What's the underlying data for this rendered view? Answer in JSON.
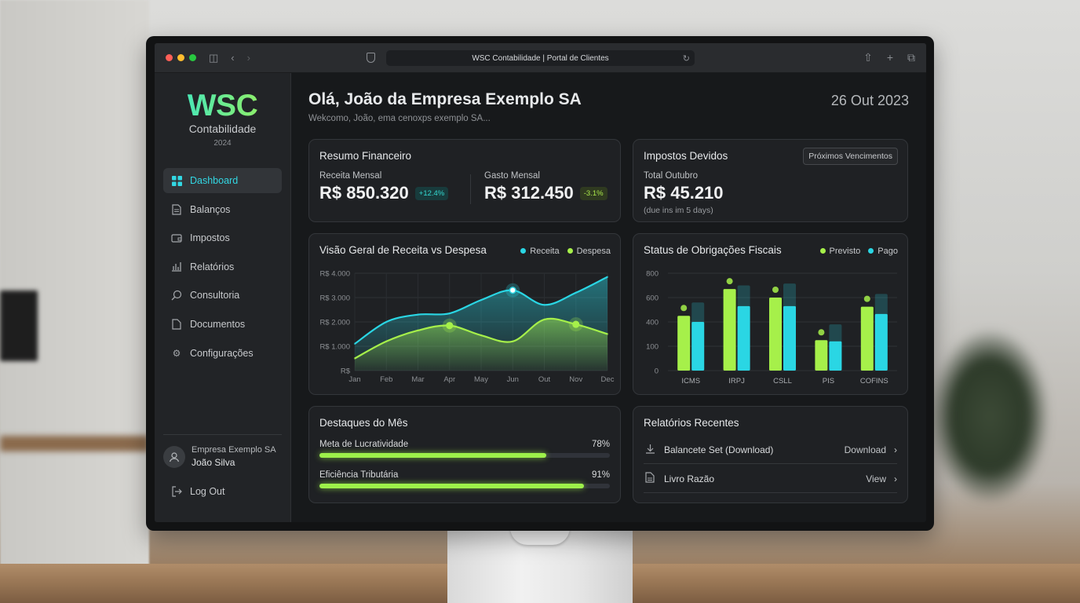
{
  "browser": {
    "url_title": "WSC Contabilidade | Portal de Clientes"
  },
  "brand": {
    "logo": "WSC",
    "subtitle": "Contabilidade",
    "year": "2024"
  },
  "sidebar": {
    "items": [
      {
        "label": "Dashboard",
        "icon": "grid-icon",
        "active": true
      },
      {
        "label": "Balanços",
        "icon": "document-icon",
        "active": false
      },
      {
        "label": "Impostos",
        "icon": "wallet-icon",
        "active": false
      },
      {
        "label": "Relatórios",
        "icon": "bar-chart-icon",
        "active": false
      },
      {
        "label": "Consultoria",
        "icon": "chat-icon",
        "active": false
      },
      {
        "label": "Documentos",
        "icon": "file-icon",
        "active": false
      },
      {
        "label": "Configurações",
        "icon": "gear-icon",
        "active": false
      }
    ],
    "user": {
      "company": "Empresa Exemplo SA",
      "name": "João Silva"
    },
    "logout": "Log Out"
  },
  "header": {
    "greeting": "Olá, João da Empresa Exemplo SA",
    "subtitle": "Wekcomo, João, ema cenoxps exemplo SA...",
    "date": "26 Out 2023"
  },
  "resumo": {
    "title": "Resumo Financeiro",
    "receita_label": "Receita Mensal",
    "receita_value": "R$ 850.320",
    "receita_change": "+12.4%",
    "gasto_label": "Gasto Mensal",
    "gasto_value": "R$ 312.450",
    "gasto_change": "-3.1%"
  },
  "impostos": {
    "title": "Impostos Devidos",
    "button": "Próximos Vencimentos",
    "total_label": "Total Outubro",
    "total_value": "R$ 45.210",
    "note": "(due ins im 5 days)"
  },
  "colors": {
    "teal": "#2ad6e4",
    "lime": "#a6f04a"
  },
  "chart_data": [
    {
      "type": "area",
      "title": "Visão Geral de Receita vs Despesa",
      "categories": [
        "Jan",
        "Feb",
        "Mar",
        "Apr",
        "May",
        "Jun",
        "Out",
        "Nov",
        "Dec"
      ],
      "y_ticks": [
        "R$",
        "R$ 1.000",
        "R$ 2.000",
        "R$ 3.000",
        "R$ 4.000"
      ],
      "ylim": [
        0,
        4000
      ],
      "grid": true,
      "legend_position": "top-right",
      "series": [
        {
          "name": "Receita",
          "color": "#2ad6e4",
          "values": [
            1100,
            2000,
            2300,
            2350,
            2900,
            3300,
            2700,
            3200,
            3850
          ]
        },
        {
          "name": "Despesa",
          "color": "#a6f04a",
          "values": [
            500,
            1200,
            1650,
            1850,
            1450,
            1200,
            2100,
            1900,
            1500
          ]
        }
      ],
      "highlights": [
        {
          "series": "Receita",
          "x": "Jun"
        },
        {
          "series": "Despesa",
          "x": "Apr"
        },
        {
          "series": "Despesa",
          "x": "Nov"
        }
      ]
    },
    {
      "type": "bar",
      "title": "Status de Obrigações Fiscais",
      "categories": [
        "ICMS",
        "IRPJ",
        "CSLL",
        "PIS",
        "COFINS"
      ],
      "y_ticks": [
        "0",
        "100",
        "400",
        "600",
        "800"
      ],
      "ylim": [
        0,
        800
      ],
      "legend_position": "top-right",
      "series": [
        {
          "name": "Previsto",
          "color": "#a6f04a",
          "values": [
            450,
            670,
            600,
            250,
            525
          ]
        },
        {
          "name": "Pago",
          "color": "#2ad6e4",
          "values": [
            400,
            530,
            530,
            240,
            465
          ],
          "ghost_totals": [
            560,
            700,
            715,
            380,
            630
          ]
        }
      ]
    }
  ],
  "destaques": {
    "title": "Destaques do Mês",
    "items": [
      {
        "label": "Meta de Lucratividade",
        "value_text": "78%",
        "value": 0.78
      },
      {
        "label": "Eficiência Tributária",
        "value_text": "91%",
        "value": 0.91
      }
    ]
  },
  "relatorios": {
    "title": "Relatórios Recentes",
    "items": [
      {
        "label": "Balancete Set (Download)",
        "action": "Download",
        "icon": "download-icon"
      },
      {
        "label": "Livro Razão",
        "action": "View",
        "icon": "file-icon"
      }
    ]
  }
}
